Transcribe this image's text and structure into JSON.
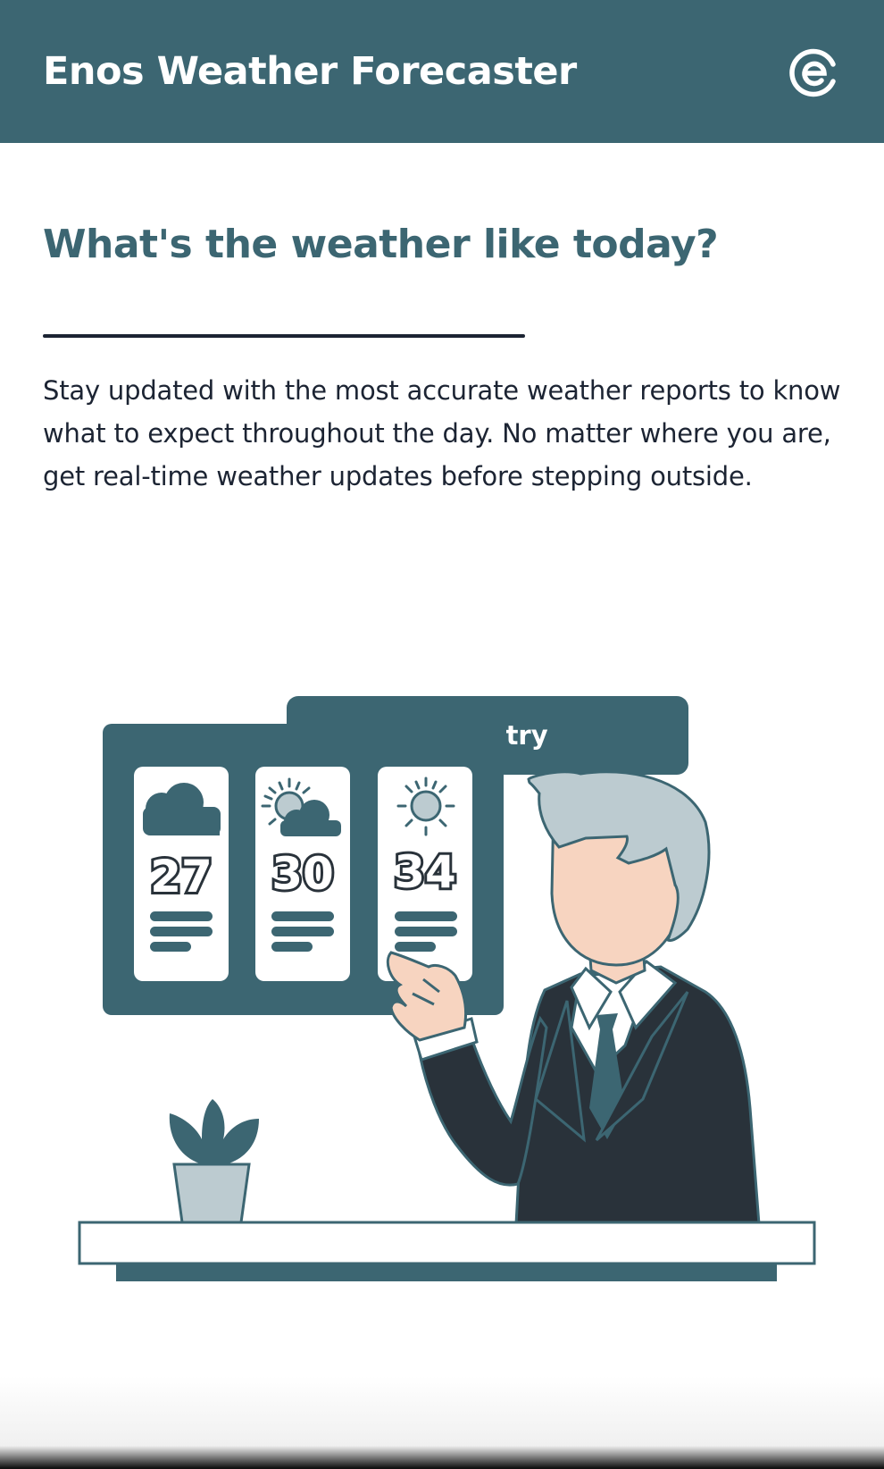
{
  "header": {
    "title": "Enos Weather Forecaster",
    "logo_icon": "enos-logo-icon"
  },
  "main": {
    "headline": "What's the weather like today?",
    "description": "Stay updated with the most accurate weather reports to know what to expect throughout the day. No matter where you are, get real-time weather updates before stepping outside.",
    "cta_label": "Let's try"
  },
  "illustration": {
    "forecast_cards": [
      {
        "temperature": "27",
        "icon": "cloud-icon"
      },
      {
        "temperature": "30",
        "icon": "partly-sunny-icon"
      },
      {
        "temperature": "34",
        "icon": "sun-icon"
      }
    ]
  },
  "colors": {
    "brand": "#3c6672",
    "text": "#1c2433",
    "suit": "#29323a",
    "hair": "#bccbd0",
    "skin": "#f7d4c0"
  }
}
